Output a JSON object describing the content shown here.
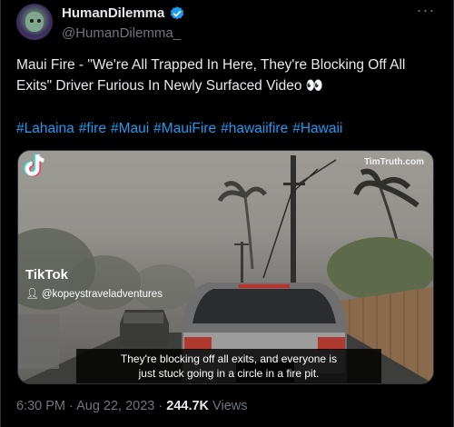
{
  "author": {
    "display_name": "HumanDilemma",
    "handle": "@HumanDilemma_",
    "verified": true
  },
  "tweet": {
    "text": "Maui Fire - \"We're All Trapped In Here, They're Blocking Off All Exits\" Driver Furious In Newly Surfaced Video 👀",
    "hashtags": [
      "#Lahaina",
      "#fire",
      "#Maui",
      "#MauiFire",
      "#hawaiifire",
      "#Hawaii"
    ]
  },
  "media": {
    "watermark": "TimTruth.com",
    "tiktok_brand": "TikTok",
    "tiktok_user": "@kopeystraveladventures",
    "caption_line1": "They're blocking off all exits, and everyone is",
    "caption_line2": "just stuck going in a circle in a fire pit."
  },
  "meta": {
    "time": "6:30 PM",
    "separator1": " · ",
    "date": "Aug 22, 2023",
    "separator2": " · ",
    "views_count": "244.7K",
    "views_label": " Views"
  },
  "colors": {
    "accent": "#1d9bf0",
    "background": "#000000",
    "muted": "#71767b"
  }
}
